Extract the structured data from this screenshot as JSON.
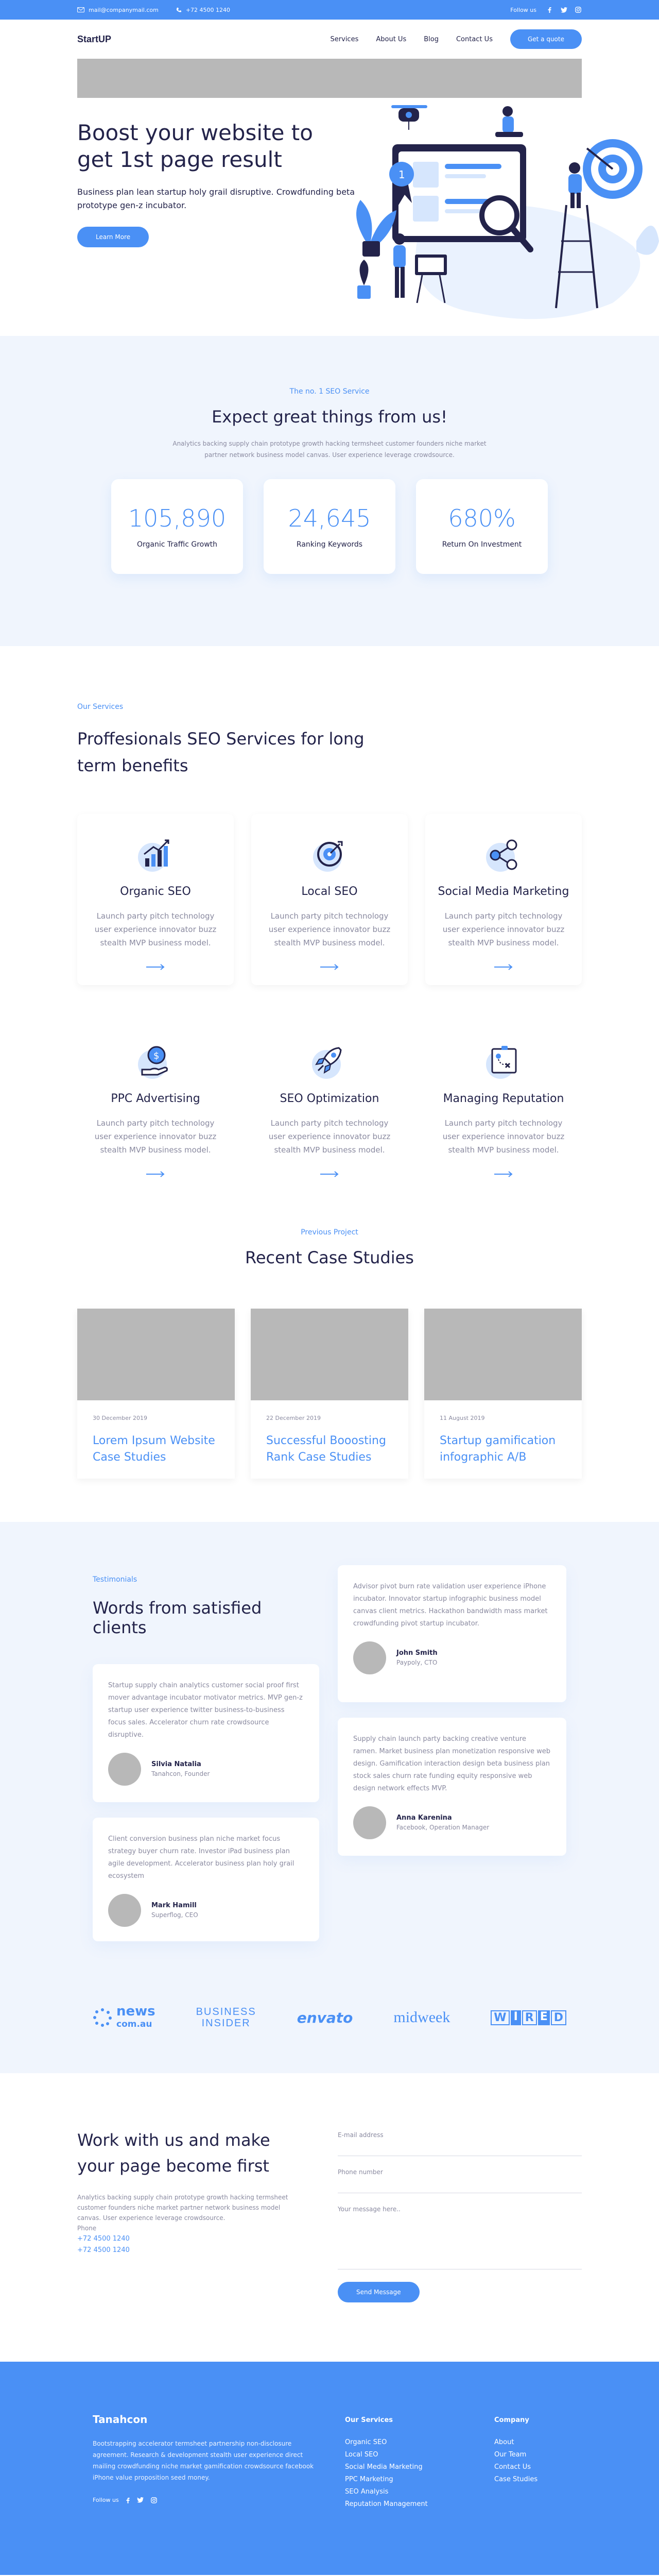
{
  "topbar": {
    "email": "mail@companymail.com",
    "phone": "+72 4500 1240",
    "follow": "Follow us"
  },
  "nav": {
    "logo": "StartUP",
    "items": [
      "Services",
      "About Us",
      "Blog",
      "Contact Us"
    ],
    "cta": "Get a quote"
  },
  "hero": {
    "title": "Boost your website to get 1st page result",
    "subtitle": "Business plan lean startup holy grail disruptive. Crowdfunding beta prototype gen-z incubator.",
    "cta": "Learn More"
  },
  "seo": {
    "eyebrow": "The no. 1 SEO Service",
    "title": "Expect great things from us!",
    "lead": "Analytics backing supply chain prototype growth hacking termsheet customer founders niche market partner network business model canvas. User experience leverage crowdsource.",
    "stats": [
      {
        "value": "105,890",
        "label": "Organic Traffic Growth"
      },
      {
        "value": "24,645",
        "label": "Ranking Keywords"
      },
      {
        "value": "680%",
        "label": "Return On Investment"
      }
    ]
  },
  "services": {
    "eyebrow": "Our Services",
    "title": "Proffesionals SEO Services for long term benefits",
    "items": [
      {
        "title": "Organic SEO",
        "text": "Launch party pitch technology user experience innovator buzz stealth MVP business model.",
        "icon": "chart-icon"
      },
      {
        "title": "Local SEO",
        "text": "Launch party pitch technology user experience innovator buzz stealth MVP business model.",
        "icon": "target-icon"
      },
      {
        "title": "Social Media Marketing",
        "text": "Launch party pitch technology user experience innovator buzz stealth MVP business model.",
        "icon": "share-icon"
      },
      {
        "title": "PPC Advertising",
        "text": "Launch party pitch technology user experience innovator buzz stealth MVP business model.",
        "icon": "dollar-hand-icon"
      },
      {
        "title": "SEO Optimization",
        "text": "Launch party pitch technology user experience innovator buzz stealth MVP business model.",
        "icon": "rocket-icon"
      },
      {
        "title": "Managing Reputation",
        "text": "Launch party pitch technology user experience innovator buzz stealth MVP business model.",
        "icon": "strategy-board-icon"
      }
    ]
  },
  "cases": {
    "eyebrow": "Previous Project",
    "title": "Recent Case Studies",
    "items": [
      {
        "date": "30 December 2019",
        "title": "Lorem Ipsum Website Case Studies"
      },
      {
        "date": "22 December 2019",
        "title": "Successful Booosting Rank Case Studies"
      },
      {
        "date": "11 August 2019",
        "title": "Startup gamification infographic A/B"
      }
    ]
  },
  "testimonials": {
    "eyebrow": "Testimonials",
    "title": "Words from satisfied clients",
    "items": [
      {
        "text": "Startup supply chain analytics customer social proof first mover advantage incubator motivator metrics. MVP gen-z startup user experience twitter business-to-business focus sales. Accelerator churn rate crowdsource disruptive.",
        "name": "Silvia Natalia",
        "role": "Tanahcon, Founder"
      },
      {
        "text": "Client conversion business plan niche market focus strategy buyer churn rate. Investor iPad business plan agile development. Accelerator business plan holy grail ecosystem",
        "name": "Mark Hamill",
        "role": "Superflog, CEO"
      },
      {
        "text": "Advisor pivot burn rate validation user experience iPhone incubator. Innovator startup infographic business model canvas client metrics. Hackathon bandwidth mass market crowdfunding pivot startup incubator.",
        "name": "John Smith",
        "role": "Paypoly, CTO"
      },
      {
        "text": "Supply chain launch party backing creative venture ramen. Market business plan monetization responsive web design. Gamification interaction design beta business plan stock sales churn rate funding equity responsive web design network effects MVP.",
        "name": "Anna Karenina",
        "role": "Facebook, Operation Manager"
      }
    ],
    "logos": [
      "news.com.au",
      "BUSINESS INSIDER",
      "envato",
      "midweek",
      "WIRED"
    ]
  },
  "contact": {
    "title": "Work with us and make your page become first",
    "text": "Analytics backing supply chain prototype growth hacking termsheet customer founders niche market partner network business model canvas. User experience leverage crowdsource.",
    "phone_label": "Phone",
    "phone1": "+72 4500 1240",
    "phone2": "+72 4500 1240",
    "email_placeholder": "E-mail address",
    "phone_placeholder": "Phone number",
    "message_placeholder": "Your message here..",
    "submit": "Send Message"
  },
  "footer": {
    "brand": "Tanahcon",
    "about": "Bootstrapping accelerator termsheet partnership non-disclosure agreement. Research & development stealth user experience direct mailing crowdfunding niche market gamification crowdsource facebook iPhone value proposition seed money.",
    "follow": "Follow us",
    "col1_title": "Our Services",
    "col1_items": [
      "Organic SEO",
      "Local SEO",
      "Social Media Marketing",
      "PPC Marketing",
      "SEO Analysis",
      "Reputation Management"
    ],
    "col2_title": "Company",
    "col2_items": [
      "About",
      "Our Team",
      "Contact Us",
      "Case Studies"
    ]
  },
  "colors": {
    "accent": "#4a90f5",
    "dark": "#23234a",
    "muted": "#8a8aa0",
    "light_bg": "#f0f5fd",
    "placeholder": "#b8b8b8"
  }
}
